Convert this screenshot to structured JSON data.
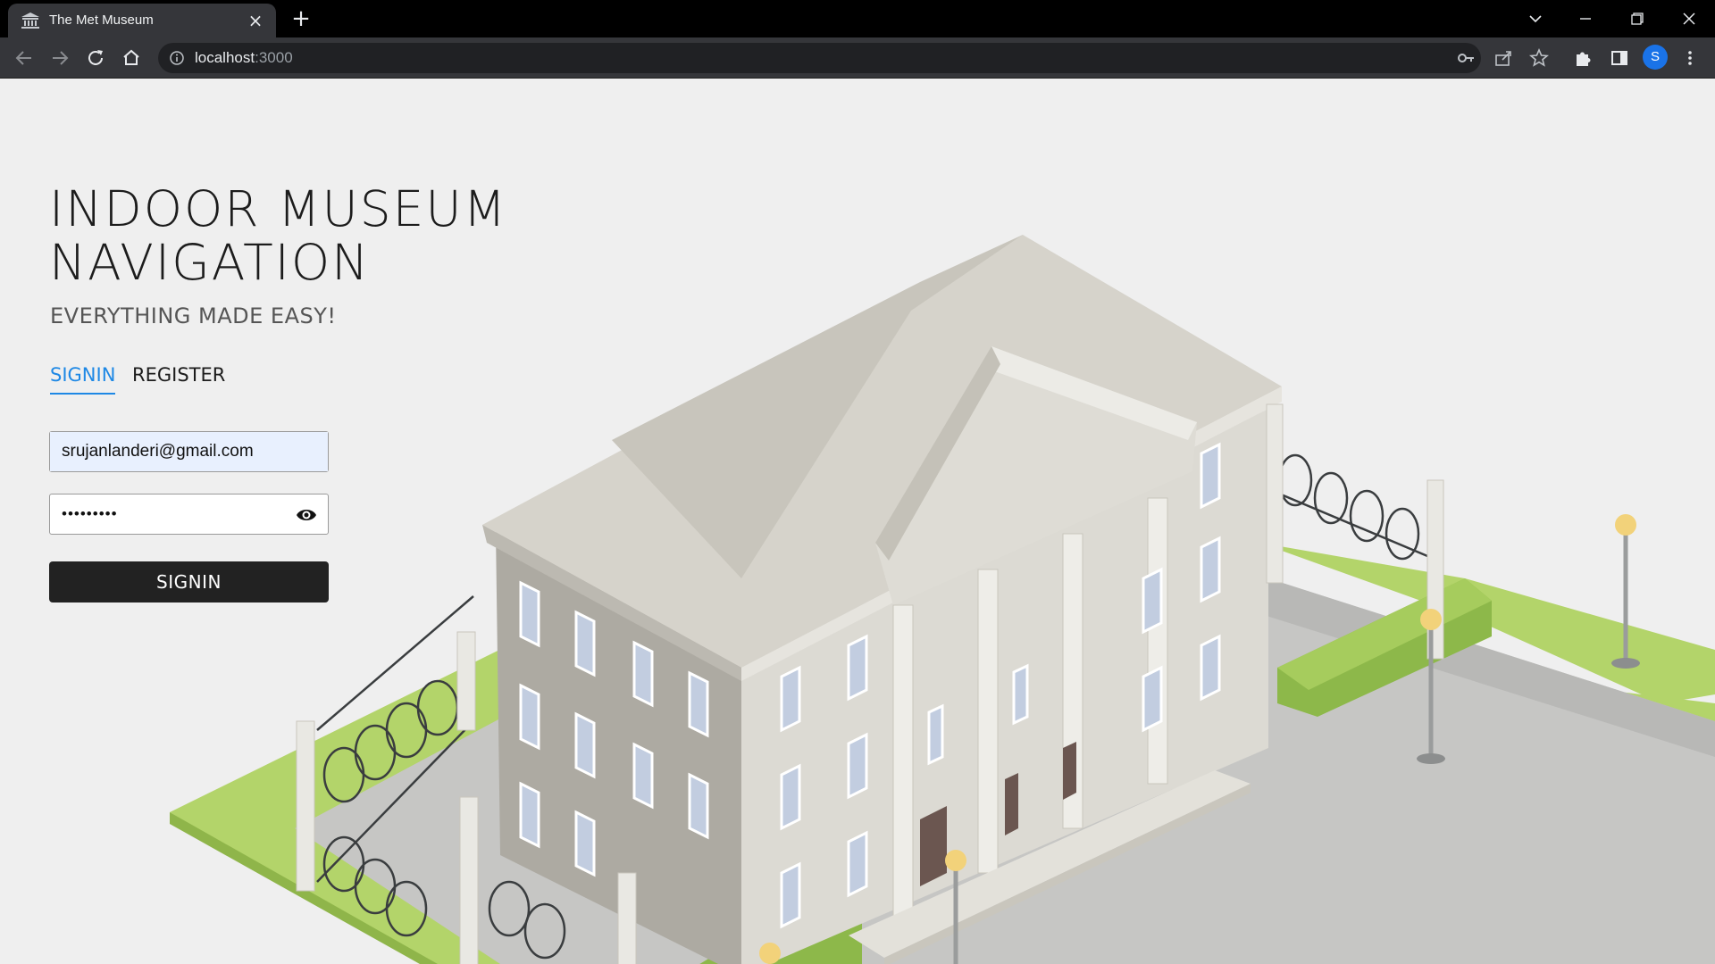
{
  "browser": {
    "tab_title": "The Met Museum",
    "url_host": "localhost",
    "url_port": ":3000",
    "profile_initial": "S"
  },
  "page": {
    "title": "INDOOR MUSEUM\nNAVIGATION",
    "subtitle": "EVERYTHING MADE EASY!",
    "tabs": [
      {
        "label": "SIGNIN",
        "active": true
      },
      {
        "label": "REGISTER",
        "active": false
      }
    ],
    "email_value": "srujanlanderi@gmail.com",
    "password_mask": "•••••••••",
    "signin_button": "SIGNIN"
  },
  "colors": {
    "accent": "#1e88e5",
    "button_bg": "#222222",
    "page_bg": "#efefef",
    "autofill_bg": "#e8f0fe"
  }
}
